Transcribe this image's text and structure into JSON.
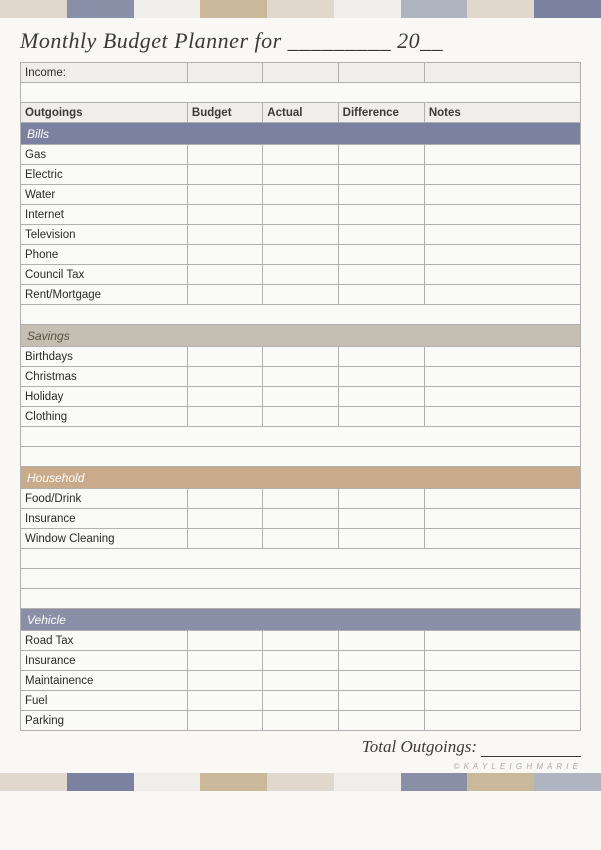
{
  "title": {
    "text": "Monthly Budget Planner for _________ 20__"
  },
  "headers": {
    "outgoings": "Outgoings",
    "budget": "Budget",
    "actual": "Actual",
    "difference": "Difference",
    "notes": "Notes"
  },
  "rows": {
    "income": {
      "label": "Income:"
    }
  },
  "sections": {
    "bills": {
      "label": "Bills",
      "rows": [
        "Gas",
        "Electric",
        "Water",
        "Internet",
        "Television",
        "Phone",
        "Council Tax",
        "Rent/Mortgage"
      ]
    },
    "savings": {
      "label": "Savings",
      "rows": [
        "Birthdays",
        "Christmas",
        "Holiday",
        "Clothing"
      ]
    },
    "household": {
      "label": "Household",
      "rows": [
        "Food/Drink",
        "Insurance",
        "Window Cleaning"
      ]
    },
    "vehicle": {
      "label": "Vehicle",
      "rows": [
        "Road Tax",
        "Insurance",
        "Maintainence",
        "Fuel",
        "Parking"
      ]
    }
  },
  "total": {
    "label": "Total Outgoings:"
  },
  "copyright": {
    "text": "© K A Y L E I G H  M A R I E"
  }
}
